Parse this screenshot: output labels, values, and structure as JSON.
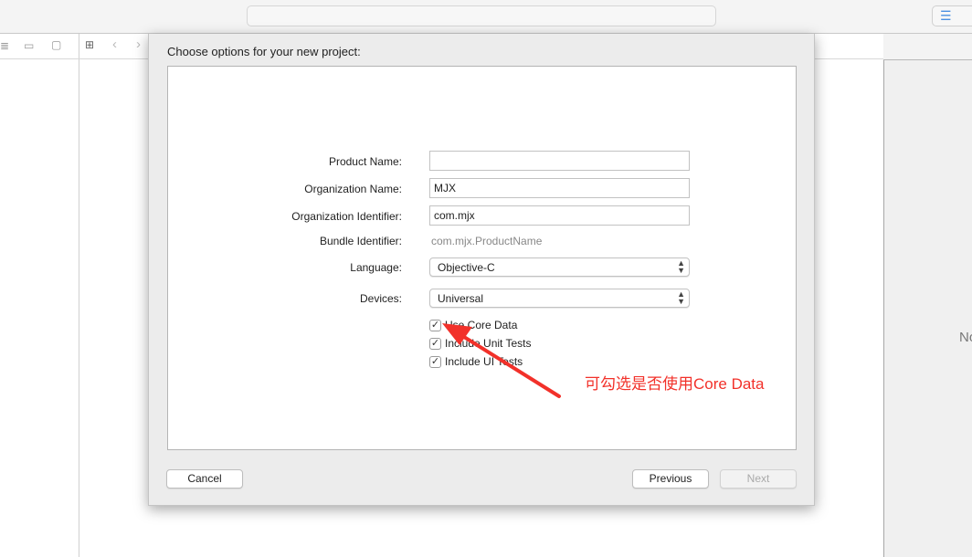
{
  "sheet": {
    "title": "Choose options for your new project:",
    "fields": [
      {
        "label": "Product Name:",
        "value": ""
      },
      {
        "label": "Organization Name:",
        "value": "MJX"
      },
      {
        "label": "Organization Identifier:",
        "value": "com.mjx"
      }
    ],
    "bundle": {
      "label": "Bundle Identifier:",
      "value": "com.mjx.ProductName"
    },
    "language": {
      "label": "Language:",
      "value": "Objective-C"
    },
    "devices": {
      "label": "Devices:",
      "value": "Universal"
    },
    "checkboxes": [
      {
        "label": "Use Core Data",
        "checked": true
      },
      {
        "label": "Include Unit Tests",
        "checked": true
      },
      {
        "label": "Include UI Tests",
        "checked": true
      }
    ],
    "buttons": {
      "cancel": "Cancel",
      "previous": "Previous",
      "next": "Next"
    }
  },
  "right_panel": {
    "text": "No"
  },
  "annotation": {
    "text": "可勾选是否使用Core Data",
    "color": "#f2312a"
  }
}
